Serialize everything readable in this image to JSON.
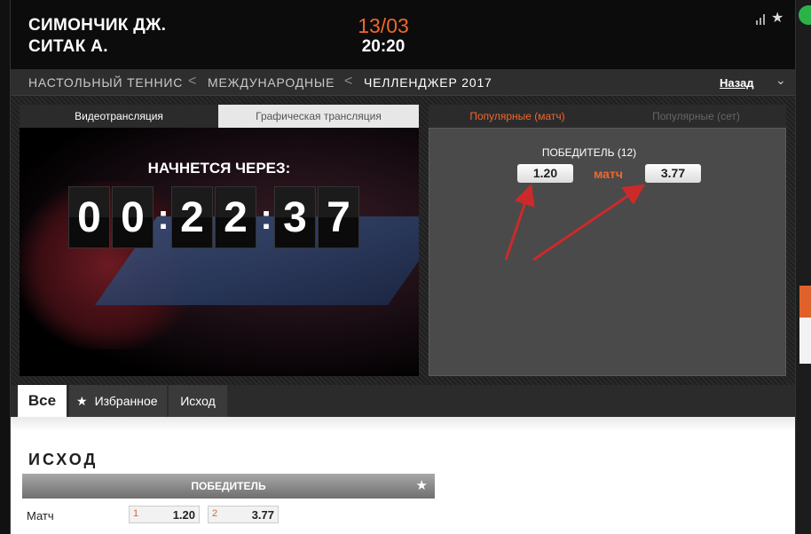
{
  "header": {
    "team1": "СИМОНЧИК ДЖ.",
    "team2": "СИТАК А.",
    "date": "13/03",
    "time": "20:20"
  },
  "breadcrumb": {
    "items": [
      "НАСТОЛЬНЫЙ ТЕННИС",
      "МЕЖДУНАРОДНЫЕ",
      "ЧЕЛЛЕНДЖЕР 2017"
    ],
    "separator": "<",
    "back": "Назад"
  },
  "video": {
    "tabs": [
      "Видеотрансляция",
      "Графическая трансляция"
    ],
    "starts_in": "НАЧНЕТСЯ ЧЕРЕЗ:",
    "countdown": [
      "0",
      "0",
      "2",
      "2",
      "3",
      "7"
    ]
  },
  "odds": {
    "tabs": [
      "Популярные (матч)",
      "Популярные (сет)"
    ],
    "winner_label": "ПОБЕДИТЕЛЬ (12)",
    "odd1": "1.20",
    "odd2": "3.77",
    "match_label": "матч"
  },
  "market_tabs": {
    "all": "Все",
    "favorites": "Избранное",
    "outcome": "Исход"
  },
  "content": {
    "section_title": "ИСХОД",
    "market_header": "ПОБЕДИТЕЛЬ",
    "row_label": "Матч",
    "cells": [
      {
        "idx": "1",
        "val": "1.20"
      },
      {
        "idx": "2",
        "val": "3.77"
      }
    ]
  },
  "colors": {
    "accent": "#f0662c",
    "arrow": "#cc2a2a",
    "status_green": "#2bb34a"
  }
}
